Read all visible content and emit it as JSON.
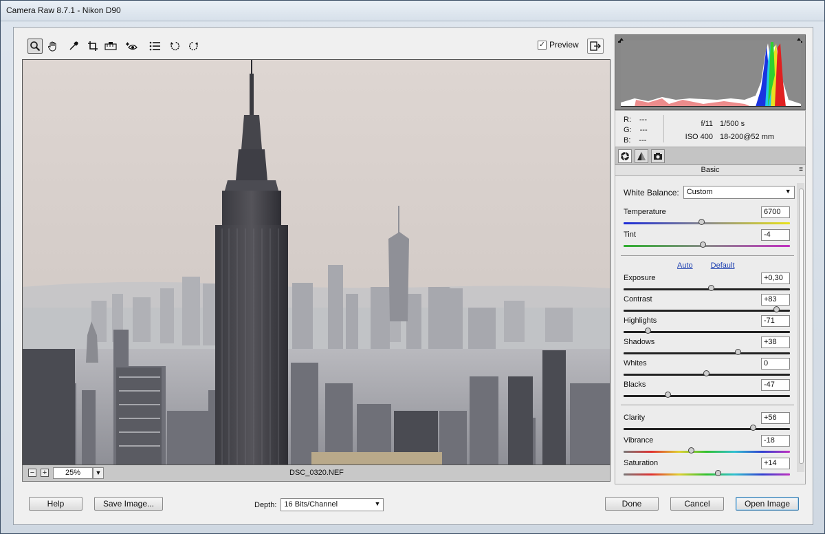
{
  "window": {
    "title": "Camera Raw 8.7.1  -  Nikon D90"
  },
  "toolbar": {
    "tools": [
      {
        "name": "zoom-tool-icon",
        "glyph": "🔍"
      },
      {
        "name": "hand-tool-icon",
        "glyph": "✋"
      },
      {
        "name": "eyedropper-icon",
        "glyph": "🖉"
      },
      {
        "name": "crop-tool-icon",
        "glyph": "⌗"
      },
      {
        "name": "straighten-tool-icon",
        "glyph": "▤"
      },
      {
        "name": "red-eye-icon",
        "glyph": "👁"
      },
      {
        "name": "preferences-list-icon",
        "glyph": "☰"
      },
      {
        "name": "rotate-left-icon",
        "glyph": "↺"
      },
      {
        "name": "rotate-right-icon",
        "glyph": "↻"
      }
    ],
    "preview_label": "Preview",
    "preview_checked": "✓",
    "fullscreen_glyph": "⇱"
  },
  "zoom": {
    "minus": "−",
    "plus": "+",
    "value": "25%",
    "dropdown": "▼"
  },
  "filename": "DSC_0320.NEF",
  "info": {
    "r_label": "R:",
    "g_label": "G:",
    "b_label": "B:",
    "r": "---",
    "g": "---",
    "b": "---",
    "aperture": "f/11",
    "shutter": "1/500 s",
    "iso": "ISO 400",
    "lens": "18-200@52 mm"
  },
  "panel": {
    "title": "Basic",
    "menu_glyph": "≡",
    "wb_label": "White Balance:",
    "wb_value": "Custom",
    "auto": "Auto",
    "default": "Default",
    "sliders": {
      "temperature": {
        "label": "Temperature",
        "value": "6700",
        "pos": 0.47
      },
      "tint": {
        "label": "Tint",
        "value": "-4",
        "pos": 0.48
      },
      "exposure": {
        "label": "Exposure",
        "value": "+0,30",
        "pos": 0.53
      },
      "contrast": {
        "label": "Contrast",
        "value": "+83",
        "pos": 0.92
      },
      "highlights": {
        "label": "Highlights",
        "value": "-71",
        "pos": 0.15
      },
      "shadows": {
        "label": "Shadows",
        "value": "+38",
        "pos": 0.69
      },
      "whites": {
        "label": "Whites",
        "value": "0",
        "pos": 0.5
      },
      "blacks": {
        "label": "Blacks",
        "value": "-47",
        "pos": 0.27
      },
      "clarity": {
        "label": "Clarity",
        "value": "+56",
        "pos": 0.78
      },
      "vibrance": {
        "label": "Vibrance",
        "value": "-18",
        "pos": 0.41
      },
      "saturation": {
        "label": "Saturation",
        "value": "+14",
        "pos": 0.57
      }
    }
  },
  "buttons": {
    "help": "Help",
    "save": "Save Image...",
    "depth_label": "Depth:",
    "depth_value": "16 Bits/Channel",
    "done": "Done",
    "cancel": "Cancel",
    "open": "Open Image"
  }
}
